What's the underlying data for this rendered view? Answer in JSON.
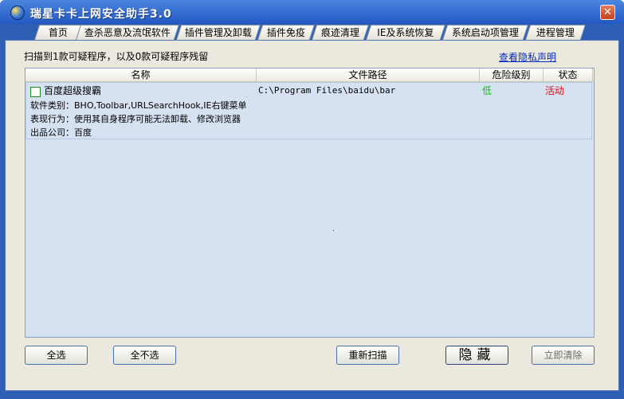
{
  "window": {
    "title": "瑞星卡卡上网安全助手3.0",
    "close_symbol": "✕"
  },
  "tabs": [
    "首页",
    "查杀恶意及流氓软件",
    "插件管理及卸载",
    "插件免疫",
    "痕迹清理",
    "IE及系统恢复",
    "系统启动项管理",
    "进程管理"
  ],
  "summary": "扫描到1款可疑程序，以及0款可疑程序残留",
  "privacy_link": "查看隐私声明",
  "table": {
    "columns": [
      "名称",
      "文件路径",
      "危险级别",
      "状态"
    ],
    "rows": [
      {
        "name": "百度超级搜霸",
        "path": "C:\\Program Files\\baidu\\bar",
        "risk": "低",
        "status": "活动",
        "category": "软件类别：BHO,Toolbar,URLSearchHook,IE右键菜单",
        "behavior": "表现行为：使用其自身程序可能无法卸载、修改浏览器",
        "company": "出品公司：百度"
      }
    ]
  },
  "buttons": {
    "select_all": "全选",
    "select_none": "全不选",
    "rescan": "重新扫描",
    "hide": "隐藏",
    "clean_now": "立即清除"
  },
  "colors": {
    "risk_low": "#10c010",
    "status_active": "#e01010",
    "link": "#0a2bb8"
  }
}
